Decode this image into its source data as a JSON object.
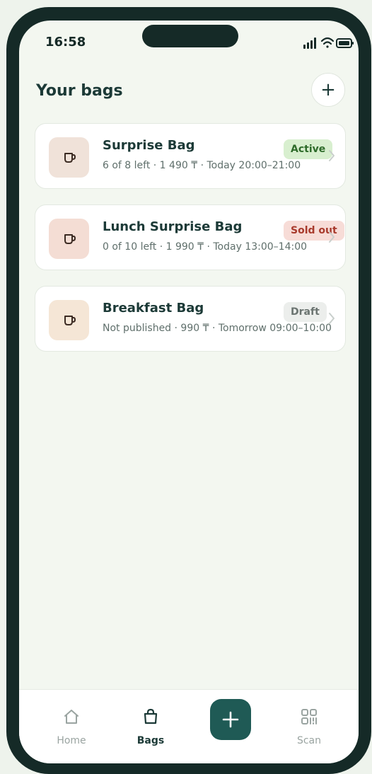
{
  "status_bar": {
    "time": "16:58",
    "icons": [
      "cellular-signal-icon",
      "wifi-icon",
      "battery-icon"
    ]
  },
  "header": {
    "title": "Your bags",
    "add_icon": "plus-icon",
    "add_symbol": "+"
  },
  "bags": [
    {
      "title": "Surprise Bag",
      "meta": "6 of 8 left · 1 490 ₸ · Today 20:00–21:00",
      "badge": "Active",
      "badge_bg": "#d8efcf",
      "badge_color": "#2e6b2a",
      "thumb_bg": "#f0e2d9",
      "icon": "cup-icon"
    },
    {
      "title": "Lunch Surprise Bag",
      "meta": "0 of 10 left · 1 990 ₸ · Today 13:00–14:00",
      "badge": "Sold out",
      "badge_bg": "#f7dcd7",
      "badge_color": "#a83a2c",
      "thumb_bg": "#f4ddd4",
      "icon": "cup-icon"
    },
    {
      "title": "Breakfast Bag",
      "meta": "Not published · 990 ₸ · Tomorrow 09:00–10:00",
      "badge": "Draft",
      "badge_bg": "#eceeec",
      "badge_color": "#6b7471",
      "thumb_bg": "#f5e6d6",
      "icon": "cup-icon"
    }
  ],
  "tabbar": {
    "home_label": "Home",
    "bags_label": "Bags",
    "scan_label": "Scan",
    "fab_icon": "plus-icon",
    "accent": "#1f5a55"
  }
}
